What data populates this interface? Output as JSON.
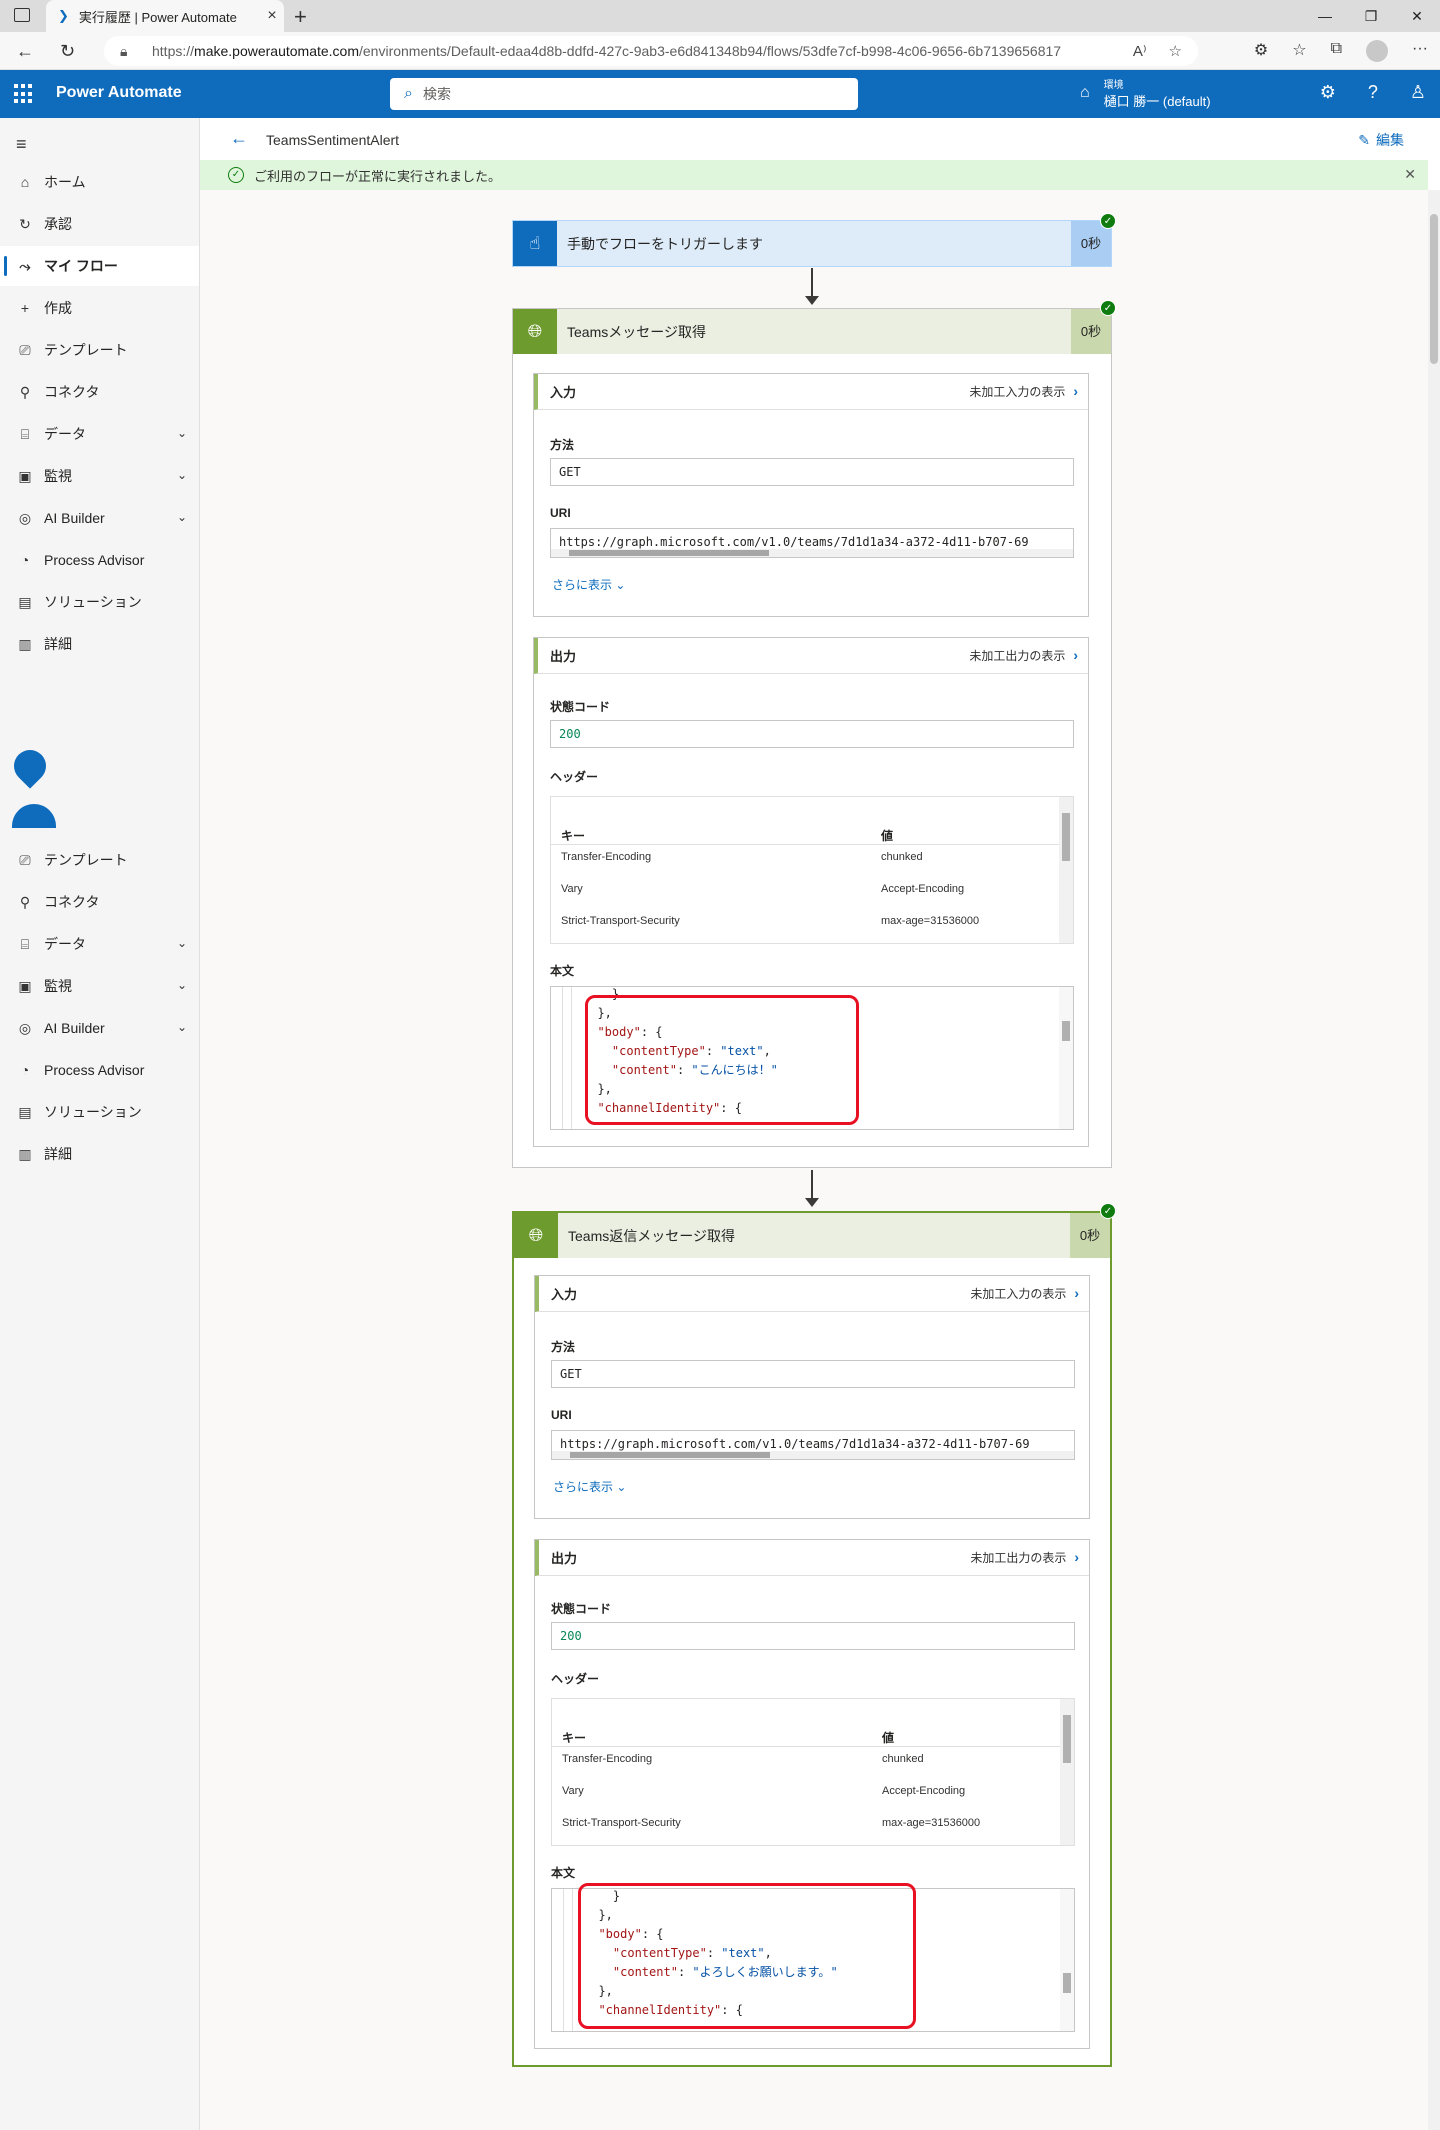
{
  "browser": {
    "tab_title": "実行履歴 | Power Automate",
    "url_prefix": "https://",
    "url_host": "make.powerautomate.com",
    "url_path": "/environments/Default-edaa4d8b-ddfd-427c-9ab3-e6d841348b94/flows/53dfe7cf-b998-4c06-9656-6b7139656817"
  },
  "app": {
    "name": "Power Automate",
    "search_placeholder": "検索",
    "env_label": "環境",
    "env_name": "樋口 勝一 (default)"
  },
  "sidebar": {
    "items": [
      {
        "label": "ホーム",
        "icon": "home-icon"
      },
      {
        "label": "承認",
        "icon": "approvals-icon"
      },
      {
        "label": "マイ フロー",
        "icon": "flows-icon",
        "active": true
      },
      {
        "label": "作成",
        "icon": "plus-icon"
      },
      {
        "label": "テンプレート",
        "icon": "template-icon"
      },
      {
        "label": "コネクタ",
        "icon": "connector-icon"
      },
      {
        "label": "データ",
        "icon": "data-icon",
        "expandable": true
      },
      {
        "label": "監視",
        "icon": "monitor-icon",
        "expandable": true
      },
      {
        "label": "AI Builder",
        "icon": "ai-icon",
        "expandable": true
      },
      {
        "label": "Process Advisor",
        "icon": "process-icon"
      },
      {
        "label": "ソリューション",
        "icon": "solution-icon"
      },
      {
        "label": "詳細",
        "icon": "book-icon"
      }
    ],
    "items_repeat": [
      {
        "label": "テンプレート"
      },
      {
        "label": "コネクタ"
      },
      {
        "label": "データ"
      },
      {
        "label": "監視"
      },
      {
        "label": "AI Builder"
      },
      {
        "label": "Process Advisor"
      },
      {
        "label": "ソリューション"
      },
      {
        "label": "詳細"
      }
    ]
  },
  "command": {
    "flow_name": "TeamsSentimentAlert",
    "edit_label": "編集"
  },
  "message": {
    "text": "ご利用のフローが正常に実行されました。"
  },
  "trigger": {
    "title": "手動でフローをトリガーします",
    "duration": "0秒"
  },
  "action1": {
    "title": "Teamsメッセージ取得",
    "duration": "0秒",
    "input_label": "入力",
    "raw_input_label": "未加工入力の表示",
    "method_label": "方法",
    "method": "GET",
    "uri_label": "URI",
    "uri": "https://graph.microsoft.com/v1.0/teams/7d1d1a34-a372-4d11-b707-69",
    "show_more": "さらに表示",
    "output_label": "出力",
    "raw_output_label": "未加工出力の表示",
    "status_label": "状態コード",
    "status": "200",
    "headers_label": "ヘッダー",
    "key_col": "キー",
    "value_col": "値",
    "headers": [
      {
        "key": "Transfer-Encoding",
        "value": "chunked"
      },
      {
        "key": "Vary",
        "value": "Accept-Encoding"
      },
      {
        "key": "Strict-Transport-Security",
        "value": "max-age=31536000"
      }
    ],
    "body_label": "本文",
    "body_content": "こんにちは！"
  },
  "action2": {
    "title": "Teams返信メッセージ取得",
    "duration": "0秒",
    "input_label": "入力",
    "raw_input_label": "未加工入力の表示",
    "method_label": "方法",
    "method": "GET",
    "uri_label": "URI",
    "uri": "https://graph.microsoft.com/v1.0/teams/7d1d1a34-a372-4d11-b707-69",
    "show_more": "さらに表示",
    "output_label": "出力",
    "raw_output_label": "未加工出力の表示",
    "status_label": "状態コード",
    "status": "200",
    "headers_label": "ヘッダー",
    "key_col": "キー",
    "value_col": "値",
    "headers": [
      {
        "key": "Transfer-Encoding",
        "value": "chunked"
      },
      {
        "key": "Vary",
        "value": "Accept-Encoding"
      },
      {
        "key": "Strict-Transport-Security",
        "value": "max-age=31536000"
      }
    ],
    "body_label": "本文",
    "body_content": "よろしくお願いします。"
  },
  "code": {
    "line_close": "}",
    "line_close_comma": "},",
    "body_key": "\"body\"",
    "content_type_key": "\"contentType\"",
    "content_type_val": "\"text\"",
    "content_key": "\"content\"",
    "channel_key": "\"channelIdentity\""
  },
  "colors": {
    "brand": "#0f6cbd",
    "action_green": "#6e9b2e",
    "success": "#107c10",
    "highlight": "#e81123"
  }
}
